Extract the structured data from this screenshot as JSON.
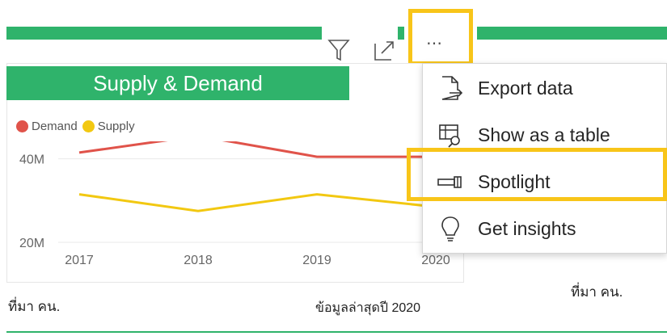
{
  "visual": {
    "title": "Supply & Demand",
    "source_left": "ที่มา คน.",
    "source_right": "ข้อมูลล่าสุดปี 2020",
    "source_far_right": "ที่มา คน."
  },
  "header_icons": {
    "filter_icon": "filter-icon",
    "focus_icon": "focus-mode-icon",
    "more_options_label": "…"
  },
  "legend": [
    {
      "label": "Demand",
      "color": "#e0534a"
    },
    {
      "label": "Supply",
      "color": "#f2c811"
    }
  ],
  "chart_data": {
    "type": "line",
    "x": [
      "2017",
      "2018",
      "2019",
      "2020"
    ],
    "series": [
      {
        "name": "Demand",
        "color": "#e0534a",
        "values": [
          41.5,
          45.5,
          40.5,
          40.5
        ]
      },
      {
        "name": "Supply",
        "color": "#f2c811",
        "values": [
          31.5,
          27.5,
          31.5,
          28.5
        ]
      }
    ],
    "yticks": [
      "20M",
      "40M"
    ],
    "ylim": [
      20,
      50
    ],
    "grid": true
  },
  "menu": {
    "items": [
      {
        "label": "Export data",
        "icon": "export-data-icon"
      },
      {
        "label": "Show as a table",
        "icon": "show-table-icon"
      },
      {
        "label": "Spotlight",
        "icon": "spotlight-icon"
      },
      {
        "label": "Get insights",
        "icon": "lightbulb-icon"
      }
    ]
  },
  "colors": {
    "accent_green": "#2fb36b",
    "highlight_yellow": "#f8c519"
  }
}
